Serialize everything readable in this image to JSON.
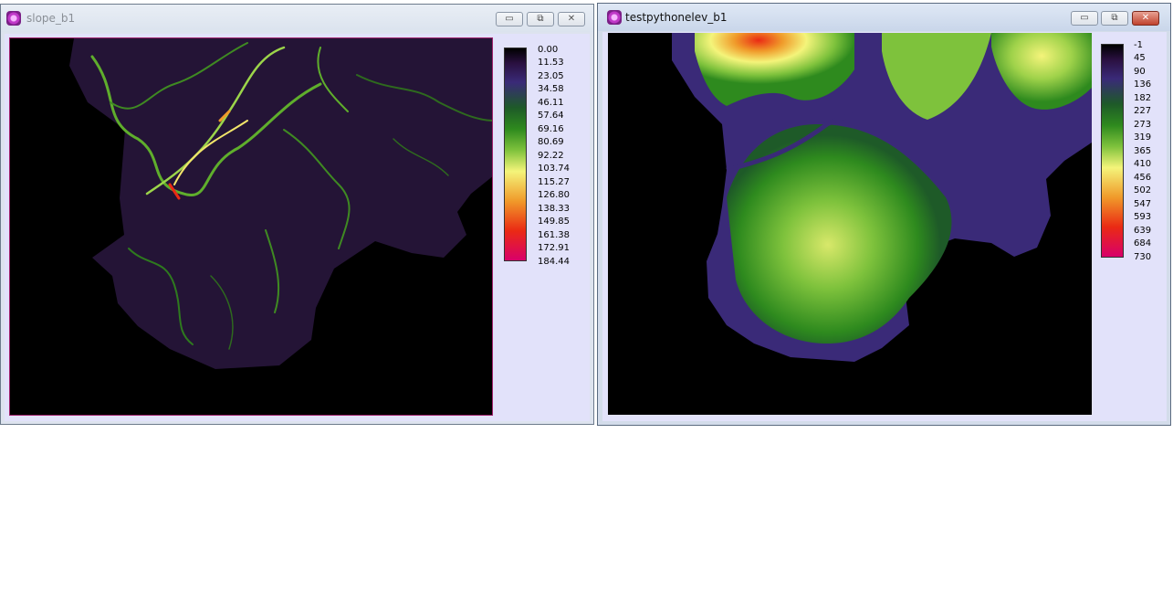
{
  "windows": [
    {
      "title": "slope_b1",
      "active": false,
      "buttons": {
        "minimize": "▭",
        "restore": "⧉",
        "close": "✕"
      },
      "legend": {
        "values": [
          "0.00",
          "11.53",
          "23.05",
          "34.58",
          "46.11",
          "57.64",
          "69.16",
          "80.69",
          "92.22",
          "103.74",
          "115.27",
          "126.80",
          "138.33",
          "149.85",
          "161.38",
          "172.91",
          "184.44"
        ]
      }
    },
    {
      "title": "testpythonelev_b1",
      "active": true,
      "buttons": {
        "minimize": "▭",
        "restore": "⧉",
        "close": "✕"
      },
      "legend": {
        "values": [
          "-1",
          "45",
          "90",
          "136",
          "182",
          "227",
          "273",
          "319",
          "365",
          "410",
          "456",
          "502",
          "547",
          "593",
          "639",
          "684",
          "730"
        ]
      }
    }
  ],
  "colors": {
    "colormap": [
      "#000000",
      "#2a1040",
      "#3a2a78",
      "#1e5a28",
      "#2e8a1e",
      "#7ec23c",
      "#f4f47a",
      "#f09a2a",
      "#ea2a14",
      "#d8006a"
    ],
    "nodata": "#000000",
    "client_bg": "#e2e2fa"
  }
}
